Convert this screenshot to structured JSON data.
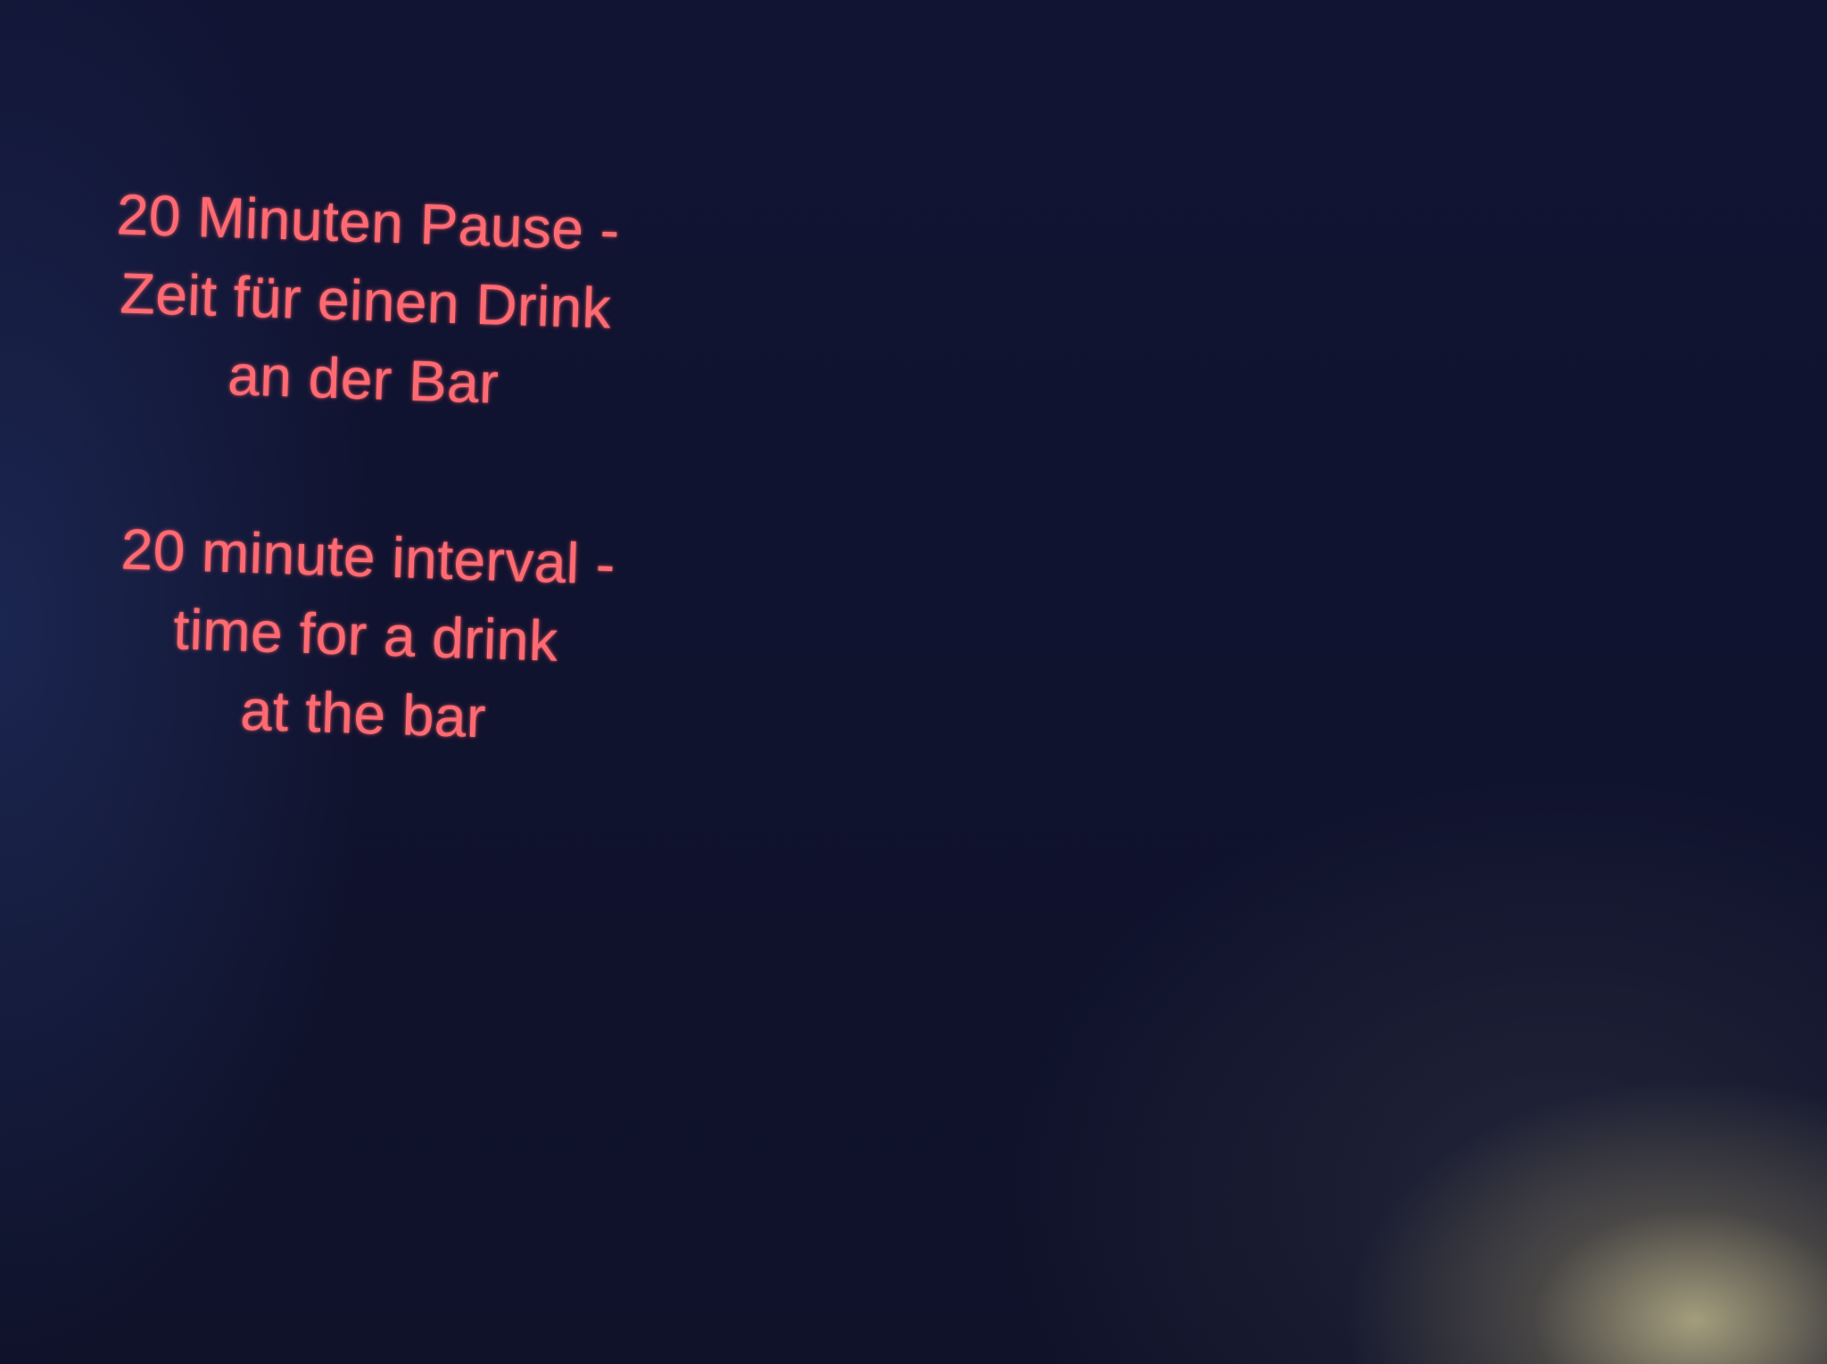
{
  "colors": {
    "background": "#10132f",
    "text": "#ff6a72",
    "glow": "#d2c896"
  },
  "message_de": {
    "lines": [
      "20 Minuten Pause -",
      "Zeit für einen Drink",
      "an der Bar"
    ]
  },
  "message_en": {
    "lines": [
      "20 minute interval -",
      "time for a drink",
      "at the bar"
    ]
  }
}
